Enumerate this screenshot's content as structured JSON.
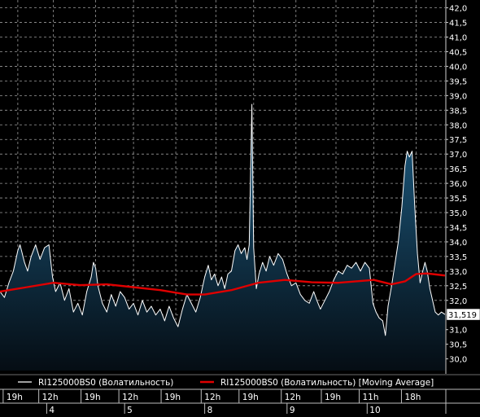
{
  "chart_data": {
    "type": "area",
    "y_axis": {
      "ylim": [
        29.6,
        42.1
      ],
      "ticks": [
        "42,0",
        "41,5",
        "41,0",
        "40,5",
        "40,0",
        "39,5",
        "39,0",
        "38,5",
        "38,0",
        "37,5",
        "37,0",
        "36,5",
        "36,0",
        "35,5",
        "35,0",
        "34,5",
        "34,0",
        "33,5",
        "33,0",
        "32,5",
        "32,0",
        "31,5",
        "31,0",
        "30,5",
        "30,0"
      ],
      "tick_values": [
        42.0,
        41.5,
        41.0,
        40.5,
        40.0,
        39.5,
        39.0,
        38.5,
        38.0,
        37.5,
        37.0,
        36.5,
        36.0,
        35.5,
        35.0,
        34.5,
        34.0,
        33.5,
        33.0,
        32.5,
        32.0,
        31.5,
        31.0,
        30.5,
        30.0
      ],
      "current_value_label": "31,519",
      "current_value": 31.519
    },
    "x_axis": {
      "time_ticks": [
        {
          "label": "19h",
          "t": 0.04
        },
        {
          "label": "12h",
          "t": 0.12
        },
        {
          "label": "19h",
          "t": 0.215
        },
        {
          "label": "12h",
          "t": 0.3
        },
        {
          "label": "19h",
          "t": 0.395
        },
        {
          "label": "12h",
          "t": 0.485
        },
        {
          "label": "19h",
          "t": 0.57
        },
        {
          "label": "12h",
          "t": 0.665
        },
        {
          "label": "19h",
          "t": 0.755
        },
        {
          "label": "11h",
          "t": 0.84
        },
        {
          "label": "18h",
          "t": 0.935
        }
      ],
      "day_ticks": [
        {
          "label": "4",
          "t": 0.105
        },
        {
          "label": "5",
          "t": 0.28
        },
        {
          "label": "8",
          "t": 0.46
        },
        {
          "label": "9",
          "t": 0.645
        },
        {
          "label": "10",
          "t": 0.825
        }
      ]
    },
    "series": [
      {
        "name": "RI125000BS0 (Волатильность)",
        "color": "#ffffff",
        "fill": "#0d3b5e",
        "points": [
          [
            0.0,
            32.3
          ],
          [
            0.01,
            32.1
          ],
          [
            0.02,
            32.6
          ],
          [
            0.03,
            33.0
          ],
          [
            0.04,
            33.7
          ],
          [
            0.045,
            33.9
          ],
          [
            0.055,
            33.3
          ],
          [
            0.062,
            33.0
          ],
          [
            0.07,
            33.5
          ],
          [
            0.08,
            33.9
          ],
          [
            0.09,
            33.4
          ],
          [
            0.1,
            33.8
          ],
          [
            0.11,
            33.9
          ],
          [
            0.118,
            32.8
          ],
          [
            0.125,
            32.3
          ],
          [
            0.135,
            32.6
          ],
          [
            0.145,
            32.0
          ],
          [
            0.155,
            32.4
          ],
          [
            0.165,
            31.6
          ],
          [
            0.175,
            31.9
          ],
          [
            0.185,
            31.5
          ],
          [
            0.195,
            32.3
          ],
          [
            0.205,
            32.8
          ],
          [
            0.21,
            33.3
          ],
          [
            0.215,
            33.1
          ],
          [
            0.22,
            32.5
          ],
          [
            0.23,
            31.9
          ],
          [
            0.24,
            31.6
          ],
          [
            0.25,
            32.2
          ],
          [
            0.26,
            31.8
          ],
          [
            0.27,
            32.3
          ],
          [
            0.28,
            32.1
          ],
          [
            0.29,
            31.7
          ],
          [
            0.3,
            31.9
          ],
          [
            0.31,
            31.5
          ],
          [
            0.32,
            32.0
          ],
          [
            0.33,
            31.6
          ],
          [
            0.34,
            31.8
          ],
          [
            0.35,
            31.5
          ],
          [
            0.36,
            31.7
          ],
          [
            0.37,
            31.3
          ],
          [
            0.38,
            31.8
          ],
          [
            0.39,
            31.4
          ],
          [
            0.4,
            31.1
          ],
          [
            0.41,
            31.7
          ],
          [
            0.42,
            32.2
          ],
          [
            0.43,
            31.9
          ],
          [
            0.44,
            31.6
          ],
          [
            0.45,
            32.1
          ],
          [
            0.46,
            32.8
          ],
          [
            0.468,
            33.2
          ],
          [
            0.475,
            32.7
          ],
          [
            0.482,
            32.9
          ],
          [
            0.49,
            32.5
          ],
          [
            0.498,
            32.8
          ],
          [
            0.505,
            32.4
          ],
          [
            0.512,
            32.9
          ],
          [
            0.52,
            33.0
          ],
          [
            0.528,
            33.7
          ],
          [
            0.535,
            33.9
          ],
          [
            0.542,
            33.6
          ],
          [
            0.55,
            33.8
          ],
          [
            0.555,
            33.4
          ],
          [
            0.56,
            33.9
          ],
          [
            0.566,
            38.7
          ],
          [
            0.57,
            33.8
          ],
          [
            0.576,
            32.4
          ],
          [
            0.582,
            32.9
          ],
          [
            0.59,
            33.3
          ],
          [
            0.598,
            33.0
          ],
          [
            0.606,
            33.5
          ],
          [
            0.615,
            33.2
          ],
          [
            0.625,
            33.6
          ],
          [
            0.635,
            33.4
          ],
          [
            0.645,
            32.9
          ],
          [
            0.655,
            32.5
          ],
          [
            0.665,
            32.6
          ],
          [
            0.675,
            32.2
          ],
          [
            0.685,
            32.0
          ],
          [
            0.695,
            31.9
          ],
          [
            0.705,
            32.3
          ],
          [
            0.712,
            32.0
          ],
          [
            0.72,
            31.7
          ],
          [
            0.73,
            32.0
          ],
          [
            0.74,
            32.3
          ],
          [
            0.75,
            32.7
          ],
          [
            0.76,
            33.0
          ],
          [
            0.77,
            32.9
          ],
          [
            0.78,
            33.2
          ],
          [
            0.79,
            33.1
          ],
          [
            0.8,
            33.3
          ],
          [
            0.81,
            33.0
          ],
          [
            0.82,
            33.3
          ],
          [
            0.83,
            33.1
          ],
          [
            0.838,
            31.9
          ],
          [
            0.845,
            31.6
          ],
          [
            0.852,
            31.4
          ],
          [
            0.86,
            31.3
          ],
          [
            0.866,
            30.8
          ],
          [
            0.872,
            31.8
          ],
          [
            0.88,
            32.5
          ],
          [
            0.888,
            33.3
          ],
          [
            0.895,
            34.0
          ],
          [
            0.903,
            35.2
          ],
          [
            0.91,
            36.6
          ],
          [
            0.915,
            37.1
          ],
          [
            0.92,
            36.9
          ],
          [
            0.926,
            37.1
          ],
          [
            0.932,
            35.2
          ],
          [
            0.938,
            33.6
          ],
          [
            0.944,
            32.6
          ],
          [
            0.95,
            33.0
          ],
          [
            0.955,
            33.3
          ],
          [
            0.96,
            33.0
          ],
          [
            0.966,
            32.4
          ],
          [
            0.972,
            32.0
          ],
          [
            0.978,
            31.6
          ],
          [
            0.985,
            31.5
          ],
          [
            0.992,
            31.6
          ],
          [
            1.0,
            31.52
          ]
        ]
      },
      {
        "name": "RI125000BS0 (Волатильность) [Moving Average]",
        "color": "#e00000",
        "points": [
          [
            0.0,
            32.3
          ],
          [
            0.06,
            32.45
          ],
          [
            0.12,
            32.6
          ],
          [
            0.18,
            32.52
          ],
          [
            0.24,
            32.55
          ],
          [
            0.3,
            32.45
          ],
          [
            0.36,
            32.35
          ],
          [
            0.42,
            32.2
          ],
          [
            0.46,
            32.2
          ],
          [
            0.52,
            32.35
          ],
          [
            0.58,
            32.6
          ],
          [
            0.64,
            32.7
          ],
          [
            0.7,
            32.62
          ],
          [
            0.76,
            32.6
          ],
          [
            0.8,
            32.65
          ],
          [
            0.84,
            32.7
          ],
          [
            0.88,
            32.55
          ],
          [
            0.91,
            32.65
          ],
          [
            0.935,
            32.9
          ],
          [
            0.96,
            32.92
          ],
          [
            1.0,
            32.85
          ]
        ]
      }
    ],
    "legend": {
      "placement": "bottom",
      "entries": [
        {
          "label": "RI125000BS0 (Волатильность)",
          "color": "#ffffff"
        },
        {
          "label": "RI125000BS0 (Волатильность) [Moving Average]",
          "color": "#e00000"
        }
      ]
    },
    "grid": true,
    "colors": {
      "background": "#000000",
      "grid": "#9a9a9a",
      "axis_text": "#ffffff",
      "fill_top": "#1e5f86",
      "fill_bottom": "#050d14",
      "price_box_bg": "#ffffff",
      "price_box_text": "#000000"
    }
  }
}
